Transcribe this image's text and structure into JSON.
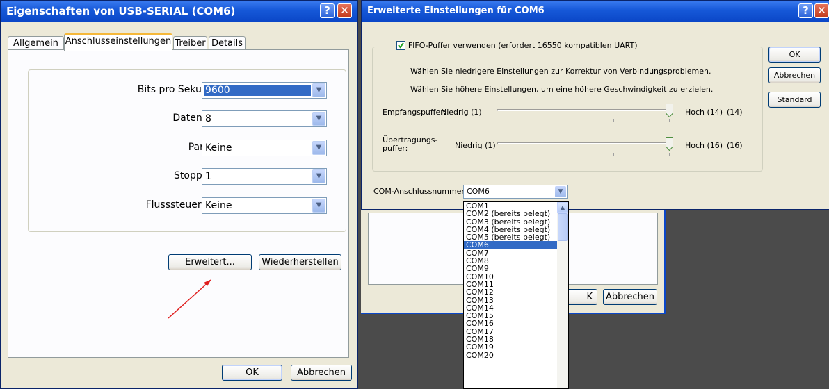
{
  "left_dialog": {
    "title": "Eigenschaften von USB-SERIAL (COM6)",
    "help_button": "?",
    "close_button": "✕",
    "tabs": [
      "Allgemein",
      "Anschlusseinstellungen",
      "Treiber",
      "Details"
    ],
    "active_tab": "Anschlusseinstellungen",
    "fields": [
      {
        "label": "Bits pro Sekunde:",
        "value": "9600"
      },
      {
        "label": "Datenbits:",
        "value": "8"
      },
      {
        "label": "Parität:",
        "value": "Keine"
      },
      {
        "label": "Stoppbits:",
        "value": "1"
      },
      {
        "label": "Flusssteuerung:",
        "value": "Keine"
      }
    ],
    "advanced_button": "Erweitert...",
    "restore_button": "Wiederherstellen",
    "ok_button": "OK",
    "cancel_button": "Abbrechen"
  },
  "right_dialog": {
    "title": "Erweiterte Einstellungen für COM6",
    "help_button": "?",
    "close_button": "✕",
    "fifo_checkbox": "FIFO-Puffer verwenden (erfordert 16550 kompatiblen UART)",
    "fifo_checked": true,
    "hint_low": "Wählen Sie niedrigere Einstellungen zur Korrektur von Verbindungsproblemen.",
    "hint_high": "Wählen Sie höhere Einstellungen, um eine höhere Geschwindigkeit zu erzielen.",
    "receive": {
      "label": "Empfangspuffer:",
      "low": "Niedrig (1)",
      "high": "Hoch (14)",
      "current": "(14)"
    },
    "transmit": {
      "label_line1": "Übertragungs-",
      "label_line2": "puffer:",
      "low": "Niedrig (1)",
      "high": "Hoch (16)",
      "current": "(16)"
    },
    "ok_button": "OK",
    "cancel_button": "Abbrechen",
    "default_button": "Standard",
    "port_label": "COM-Anschlussnummer:",
    "port_value": "COM6",
    "port_options": [
      "COM1",
      "COM2 (bereits belegt)",
      "COM3 (bereits belegt)",
      "COM4 (bereits belegt)",
      "COM5 (bereits belegt)",
      "COM6",
      "COM7",
      "COM8",
      "COM9",
      "COM10",
      "COM11",
      "COM12",
      "COM13",
      "COM14",
      "COM15",
      "COM16",
      "COM17",
      "COM18",
      "COM19",
      "COM20"
    ],
    "selected_option": "COM6"
  },
  "background_dialog": {
    "ok_partial": "K",
    "cancel_button": "Abbrechen"
  }
}
